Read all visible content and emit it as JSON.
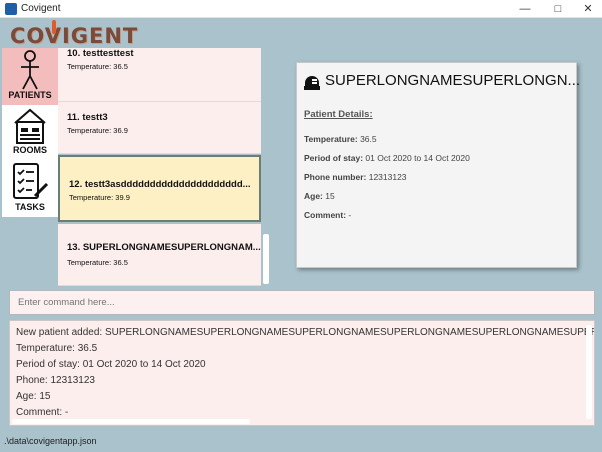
{
  "window": {
    "title": "Covigent"
  },
  "logo": {
    "text": "COVIGENT"
  },
  "nav": {
    "items": [
      {
        "label": "PATIENTS",
        "icon": "person-icon",
        "active": true
      },
      {
        "label": "ROOMS",
        "icon": "bed-icon",
        "active": false
      },
      {
        "label": "TASKS",
        "icon": "checklist-icon",
        "active": false
      }
    ]
  },
  "patients": [
    {
      "title": "10.  testtesttest",
      "temperature": "Temperature: 36.5"
    },
    {
      "title": "11.  testt3",
      "temperature": "Temperature: 36.9"
    },
    {
      "title": "12.  testt3asddddddddddddddddddddd...",
      "temperature": "Temperature: 39.9",
      "selected": true
    },
    {
      "title": "13.  SUPERLONGNAMESUPERLONGNAM...",
      "temperature": "Temperature: 36.5"
    }
  ],
  "details": {
    "icon": "patient-id-icon",
    "name": "SUPERLONGNAMESUPERLONGN...",
    "heading": "Patient Details:",
    "temperature_label": "Temperature:",
    "temperature_value": "36.5",
    "stay_label": "Period of stay:",
    "stay_value": "01 Oct 2020 to 14 Oct 2020",
    "phone_label": "Phone number:",
    "phone_value": "12313123",
    "age_label": "Age:",
    "age_value": "15",
    "comment_label": "Comment:",
    "comment_value": "-"
  },
  "command": {
    "placeholder": "Enter command here..."
  },
  "result": {
    "lines": [
      "New patient added: SUPERLONGNAMESUPERLONGNAMESUPERLONGNAMESUPERLONGNAMESUPERLONGNAMESUPERLONGNA",
      "Temperature: 36.5",
      "Period of stay: 01 Oct 2020 to 14 Oct 2020",
      "Phone: 12313123",
      "Age: 15",
      "Comment: -"
    ]
  },
  "status": {
    "path": ".\\data\\covigentapp.json"
  },
  "colors": {
    "background": "#a9c2cc",
    "active_nav": "#f4bdbd",
    "selected_card": "#fcf0c4",
    "card": "#fdeeee"
  }
}
